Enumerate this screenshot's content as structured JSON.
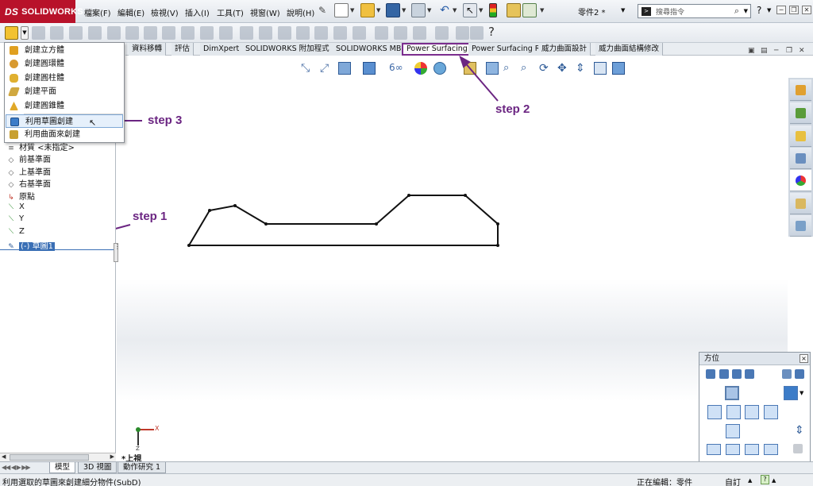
{
  "app": {
    "logo": "SOLIDWORKS",
    "logo_mark": "DS",
    "doc_title": "零件2 *"
  },
  "menu": [
    "檔案(F)",
    "編輯(E)",
    "檢視(V)",
    "插入(I)",
    "工具(T)",
    "視窗(W)",
    "說明(H)"
  ],
  "search": {
    "placeholder": "搜尋指令",
    "prompt_glyph": ">"
  },
  "help_label": "?",
  "window_buttons": [
    "─",
    "❐",
    "✕"
  ],
  "tabs": [
    "資料移轉",
    "評估",
    "DimXpert",
    "SOLIDWORKS 附加程式",
    "SOLIDWORKS MBD",
    "Power Surfacing",
    "Power Surfacing RE",
    "威力曲面設計",
    "威力曲面結構修改"
  ],
  "dropdown": {
    "items": [
      {
        "label": "創建立方體",
        "icon_color": "#e0a020"
      },
      {
        "label": "創建圓環體",
        "icon_color": "#d89a30"
      },
      {
        "label": "創建圓柱體",
        "icon_color": "#e0b030"
      },
      {
        "label": "創建平面",
        "icon_color": "#d0a840"
      },
      {
        "label": "創建圓錐體",
        "icon_color": "#e0a828"
      },
      {
        "label": "利用草圖創建",
        "icon_color": "#3c7cc8"
      },
      {
        "label": "利用曲面來創建",
        "icon_color": "#c8a030"
      }
    ]
  },
  "tree": {
    "items": [
      {
        "label": "材質 <未指定>",
        "icon": "material-icon",
        "glyph": "≡"
      },
      {
        "label": "前基準面",
        "icon": "plane-icon",
        "glyph": "◇"
      },
      {
        "label": "上基準面",
        "icon": "plane-icon",
        "glyph": "◇"
      },
      {
        "label": "右基準面",
        "icon": "plane-icon",
        "glyph": "◇"
      },
      {
        "label": "原點",
        "icon": "origin-icon",
        "glyph": "↳"
      },
      {
        "label": "X",
        "icon": "axis-icon",
        "glyph": "⟍"
      },
      {
        "label": "Y",
        "icon": "axis-icon",
        "glyph": "⟍"
      },
      {
        "label": "Z",
        "icon": "axis-icon",
        "glyph": "⟍"
      },
      {
        "label": "(-) 草圖1",
        "icon": "sketch-icon",
        "glyph": "✎"
      }
    ]
  },
  "annotations": {
    "step1": "step 1",
    "step2": "step 2",
    "step3": "step 3",
    "color": "#6b2582"
  },
  "view": {
    "name": "*上視",
    "triad_x": "X",
    "triad_z": "Z"
  },
  "orientation_panel": {
    "title": "方位",
    "close": "×"
  },
  "bottom_tabs": [
    "模型",
    "3D 視圖",
    "動作研究 1"
  ],
  "status": {
    "message": "利用選取的草圖來創建細分物件(SubD)",
    "editing": "正在編輯：零件",
    "units": "自訂"
  },
  "colors": {
    "brand": "#b8122a",
    "selection": "#3a6fb5",
    "highlight_tab_border": "#7b2d8e"
  }
}
